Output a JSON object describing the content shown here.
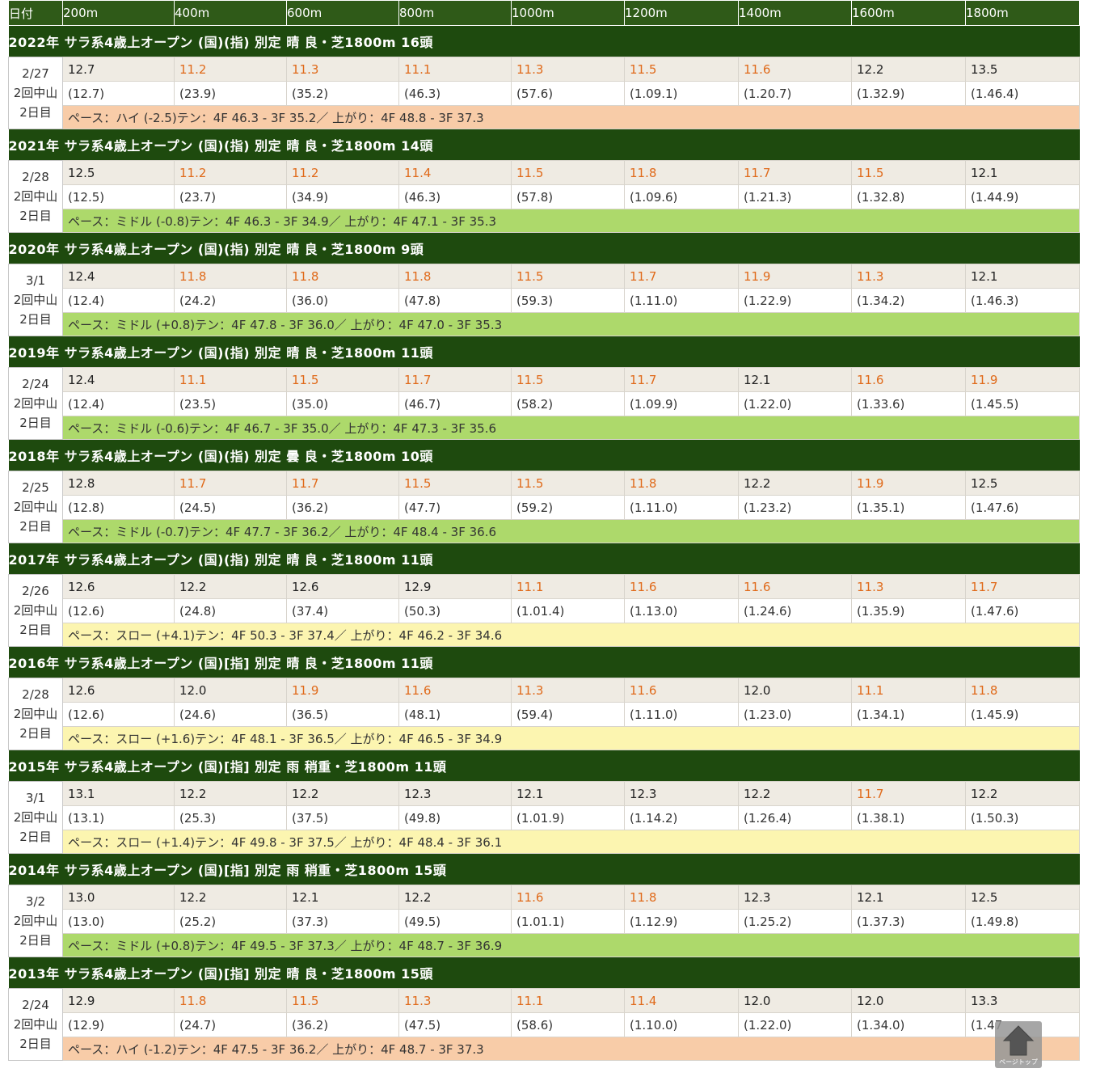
{
  "header": {
    "date_label": "日付",
    "distances": [
      "200m",
      "400m",
      "600m",
      "800m",
      "1000m",
      "1200m",
      "1400m",
      "1600m",
      "1800m"
    ]
  },
  "races": [
    {
      "title": "2022年  サラ系4歳上オープン (国)(指) 別定  晴 良・芝1800m   16頭",
      "date": "2/27",
      "venue": "2回中山",
      "day": "2日目",
      "splits": [
        "12.7",
        "11.2",
        "11.3",
        "11.1",
        "11.3",
        "11.5",
        "11.6",
        "12.2",
        "13.5"
      ],
      "fast": [
        false,
        true,
        true,
        true,
        true,
        true,
        true,
        false,
        false
      ],
      "cumulative": [
        "(12.7)",
        "(23.9)",
        "(35.2)",
        "(46.3)",
        "(57.6)",
        "(1.09.1)",
        "(1.20.7)",
        "(1.32.9)",
        "(1.46.4)"
      ],
      "pace": "ペース：ハイ (-2.5)テン：4F 46.3 - 3F 35.2／ 上がり：4F 48.8 - 3F 37.3",
      "pace_type": "hi"
    },
    {
      "title": "2021年  サラ系4歳上オープン (国)(指) 別定  晴 良・芝1800m   14頭",
      "date": "2/28",
      "venue": "2回中山",
      "day": "2日目",
      "splits": [
        "12.5",
        "11.2",
        "11.2",
        "11.4",
        "11.5",
        "11.8",
        "11.7",
        "11.5",
        "12.1"
      ],
      "fast": [
        false,
        true,
        true,
        true,
        true,
        true,
        true,
        true,
        false
      ],
      "cumulative": [
        "(12.5)",
        "(23.7)",
        "(34.9)",
        "(46.3)",
        "(57.8)",
        "(1.09.6)",
        "(1.21.3)",
        "(1.32.8)",
        "(1.44.9)"
      ],
      "pace": "ペース：ミドル (-0.8)テン：4F 46.3 - 3F 34.9／ 上がり：4F 47.1 - 3F 35.3",
      "pace_type": "mid"
    },
    {
      "title": "2020年  サラ系4歳上オープン (国)(指) 別定  晴 良・芝1800m   9頭",
      "date": "3/1",
      "venue": "2回中山",
      "day": "2日目",
      "splits": [
        "12.4",
        "11.8",
        "11.8",
        "11.8",
        "11.5",
        "11.7",
        "11.9",
        "11.3",
        "12.1"
      ],
      "fast": [
        false,
        true,
        true,
        true,
        true,
        true,
        true,
        true,
        false
      ],
      "cumulative": [
        "(12.4)",
        "(24.2)",
        "(36.0)",
        "(47.8)",
        "(59.3)",
        "(1.11.0)",
        "(1.22.9)",
        "(1.34.2)",
        "(1.46.3)"
      ],
      "pace": "ペース：ミドル (+0.8)テン：4F 47.8 - 3F 36.0／ 上がり：4F 47.0 - 3F 35.3",
      "pace_type": "mid"
    },
    {
      "title": "2019年  サラ系4歳上オープン (国)(指) 別定  晴 良・芝1800m   11頭",
      "date": "2/24",
      "venue": "2回中山",
      "day": "2日目",
      "splits": [
        "12.4",
        "11.1",
        "11.5",
        "11.7",
        "11.5",
        "11.7",
        "12.1",
        "11.6",
        "11.9"
      ],
      "fast": [
        false,
        true,
        true,
        true,
        true,
        true,
        false,
        true,
        true
      ],
      "cumulative": [
        "(12.4)",
        "(23.5)",
        "(35.0)",
        "(46.7)",
        "(58.2)",
        "(1.09.9)",
        "(1.22.0)",
        "(1.33.6)",
        "(1.45.5)"
      ],
      "pace": "ペース：ミドル (-0.6)テン：4F 46.7 - 3F 35.0／ 上がり：4F 47.3 - 3F 35.6",
      "pace_type": "mid"
    },
    {
      "title": "2018年  サラ系4歳上オープン (国)(指) 別定  曇 良・芝1800m   10頭",
      "date": "2/25",
      "venue": "2回中山",
      "day": "2日目",
      "splits": [
        "12.8",
        "11.7",
        "11.7",
        "11.5",
        "11.5",
        "11.8",
        "12.2",
        "11.9",
        "12.5"
      ],
      "fast": [
        false,
        true,
        true,
        true,
        true,
        true,
        false,
        true,
        false
      ],
      "cumulative": [
        "(12.8)",
        "(24.5)",
        "(36.2)",
        "(47.7)",
        "(59.2)",
        "(1.11.0)",
        "(1.23.2)",
        "(1.35.1)",
        "(1.47.6)"
      ],
      "pace": "ペース：ミドル (-0.7)テン：4F 47.7 - 3F 36.2／ 上がり：4F 48.4 - 3F 36.6",
      "pace_type": "mid"
    },
    {
      "title": "2017年  サラ系4歳上オープン (国)(指) 別定  晴 良・芝1800m   11頭",
      "date": "2/26",
      "venue": "2回中山",
      "day": "2日目",
      "splits": [
        "12.6",
        "12.2",
        "12.6",
        "12.9",
        "11.1",
        "11.6",
        "11.6",
        "11.3",
        "11.7"
      ],
      "fast": [
        false,
        false,
        false,
        false,
        true,
        true,
        true,
        true,
        true
      ],
      "cumulative": [
        "(12.6)",
        "(24.8)",
        "(37.4)",
        "(50.3)",
        "(1.01.4)",
        "(1.13.0)",
        "(1.24.6)",
        "(1.35.9)",
        "(1.47.6)"
      ],
      "pace": "ペース：スロー (+4.1)テン：4F 50.3 - 3F 37.4／ 上がり：4F 46.2 - 3F 34.6",
      "pace_type": "slow"
    },
    {
      "title": "2016年  サラ系4歳上オープン (国)[指] 別定  晴 良・芝1800m   11頭",
      "date": "2/28",
      "venue": "2回中山",
      "day": "2日目",
      "splits": [
        "12.6",
        "12.0",
        "11.9",
        "11.6",
        "11.3",
        "11.6",
        "12.0",
        "11.1",
        "11.8"
      ],
      "fast": [
        false,
        false,
        true,
        true,
        true,
        true,
        false,
        true,
        true
      ],
      "cumulative": [
        "(12.6)",
        "(24.6)",
        "(36.5)",
        "(48.1)",
        "(59.4)",
        "(1.11.0)",
        "(1.23.0)",
        "(1.34.1)",
        "(1.45.9)"
      ],
      "pace": "ペース：スロー (+1.6)テン：4F 48.1 - 3F 36.5／ 上がり：4F 46.5 - 3F 34.9",
      "pace_type": "slow"
    },
    {
      "title": "2015年  サラ系4歳上オープン (国)[指] 別定  雨 稍重・芝1800m   11頭",
      "date": "3/1",
      "venue": "2回中山",
      "day": "2日目",
      "splits": [
        "13.1",
        "12.2",
        "12.2",
        "12.3",
        "12.1",
        "12.3",
        "12.2",
        "11.7",
        "12.2"
      ],
      "fast": [
        false,
        false,
        false,
        false,
        false,
        false,
        false,
        true,
        false
      ],
      "cumulative": [
        "(13.1)",
        "(25.3)",
        "(37.5)",
        "(49.8)",
        "(1.01.9)",
        "(1.14.2)",
        "(1.26.4)",
        "(1.38.1)",
        "(1.50.3)"
      ],
      "pace": "ペース：スロー (+1.4)テン：4F 49.8 - 3F 37.5／ 上がり：4F 48.4 - 3F 36.1",
      "pace_type": "slow"
    },
    {
      "title": "2014年  サラ系4歳上オープン (国)[指] 別定  雨 稍重・芝1800m   15頭",
      "date": "3/2",
      "venue": "2回中山",
      "day": "2日目",
      "splits": [
        "13.0",
        "12.2",
        "12.1",
        "12.2",
        "11.6",
        "11.8",
        "12.3",
        "12.1",
        "12.5"
      ],
      "fast": [
        false,
        false,
        false,
        false,
        true,
        true,
        false,
        false,
        false
      ],
      "cumulative": [
        "(13.0)",
        "(25.2)",
        "(37.3)",
        "(49.5)",
        "(1.01.1)",
        "(1.12.9)",
        "(1.25.2)",
        "(1.37.3)",
        "(1.49.8)"
      ],
      "pace": "ペース：ミドル (+0.8)テン：4F 49.5 - 3F 37.3／ 上がり：4F 48.7 - 3F 36.9",
      "pace_type": "mid"
    },
    {
      "title": "2013年  サラ系4歳上オープン (国)[指] 別定  晴 良・芝1800m   15頭",
      "date": "2/24",
      "venue": "2回中山",
      "day": "2日目",
      "splits": [
        "12.9",
        "11.8",
        "11.5",
        "11.3",
        "11.1",
        "11.4",
        "12.0",
        "12.0",
        "13.3"
      ],
      "fast": [
        false,
        true,
        true,
        true,
        true,
        true,
        false,
        false,
        false
      ],
      "cumulative": [
        "(12.9)",
        "(24.7)",
        "(36.2)",
        "(47.5)",
        "(58.6)",
        "(1.10.0)",
        "(1.22.0)",
        "(1.34.0)",
        "(1.47"
      ],
      "pace": "ペース：ハイ (-1.2)テン：4F 47.5 - 3F 36.2／ 上がり：4F 48.7 - 3F 37.3",
      "pace_type": "hi"
    }
  ],
  "page_top": {
    "label": "ページトップ",
    "icon": "arrow-up-icon"
  },
  "colors": {
    "header_green": "#1e4a0e",
    "fast_orange": "#e06a1a",
    "pace_hi": "#f8cca8",
    "pace_mid": "#add96b",
    "pace_slow": "#fcf5b0"
  }
}
